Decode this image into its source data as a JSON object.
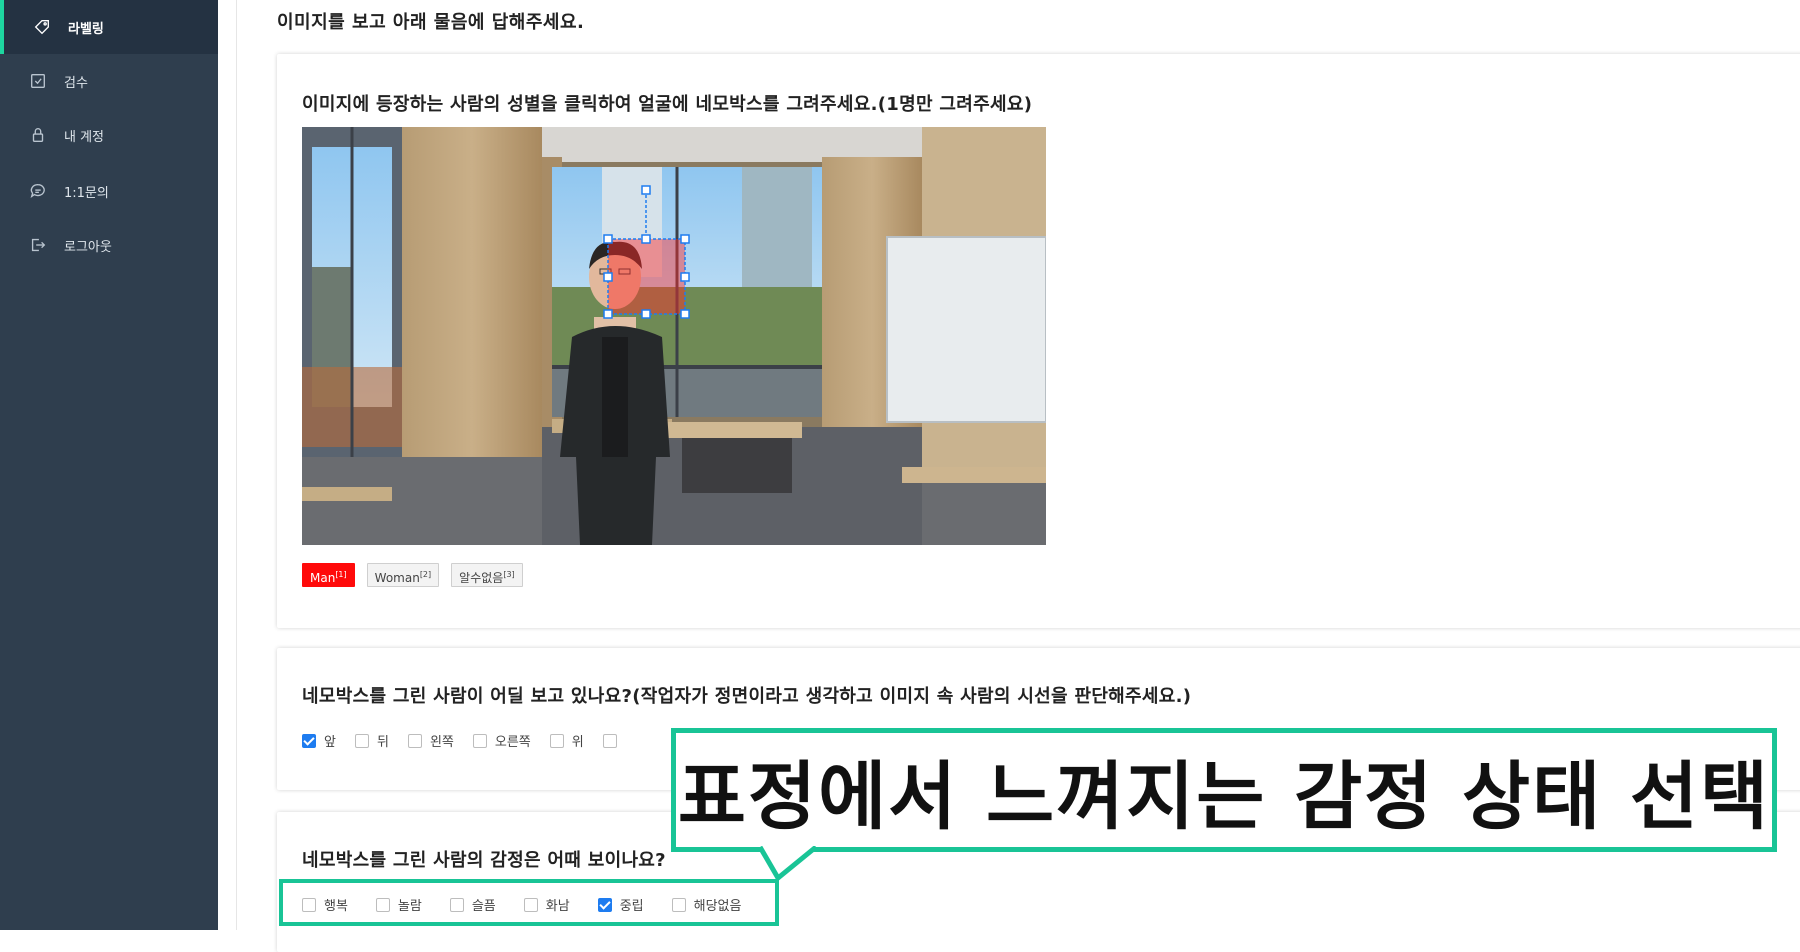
{
  "sidebar": {
    "items": [
      {
        "label": "라벨링",
        "icon": "tag-icon",
        "active": true
      },
      {
        "label": "검수",
        "icon": "check-square-icon",
        "active": false
      },
      {
        "label": "내 계정",
        "icon": "lock-icon",
        "active": false
      },
      {
        "label": "1:1문의",
        "icon": "chat-icon",
        "active": false
      },
      {
        "label": "로그아웃",
        "icon": "logout-icon",
        "active": false
      }
    ]
  },
  "main": {
    "instruction": "이미지를 보고 아래 물음에 답해주세요.",
    "q1": {
      "title": "이미지에 등장하는 사람의 성별을 클릭하여 얼굴에 네모박스를 그려주세요.(1명만 그려주세요)",
      "options": [
        {
          "label": "Man",
          "key": "[1]",
          "selected": true
        },
        {
          "label": "Woman",
          "key": "[2]",
          "selected": false
        },
        {
          "label": "알수없음",
          "key": "[3]",
          "selected": false
        }
      ]
    },
    "q2": {
      "title": "네모박스를 그린 사람이 어딜 보고 있나요?(작업자가 정면이라고 생각하고 이미지 속 사람의 시선을 판단해주세요.)",
      "options": [
        {
          "label": "앞",
          "checked": true
        },
        {
          "label": "뒤",
          "checked": false
        },
        {
          "label": "왼쪽",
          "checked": false
        },
        {
          "label": "오른쪽",
          "checked": false
        },
        {
          "label": "위",
          "checked": false
        }
      ]
    },
    "q3": {
      "title": "네모박스를 그린 사람의 감정은 어때 보이나요?",
      "options": [
        {
          "label": "행복",
          "checked": false
        },
        {
          "label": "놀람",
          "checked": false
        },
        {
          "label": "슬픔",
          "checked": false
        },
        {
          "label": "화남",
          "checked": false
        },
        {
          "label": "중립",
          "checked": true
        },
        {
          "label": "해당없음",
          "checked": false
        }
      ]
    }
  },
  "callout": {
    "text": "표정에서 느껴지는 감정 상태 선택"
  },
  "colors": {
    "sidebar_bg": "#2f3e4e",
    "accent": "#19c496",
    "selected_tag": "#ff0a0a",
    "checkbox": "#1e7cf0"
  }
}
